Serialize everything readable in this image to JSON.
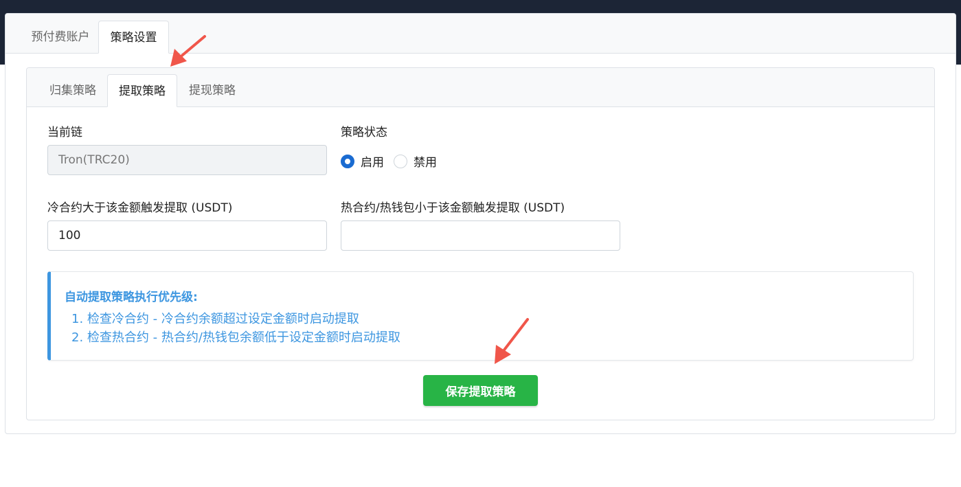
{
  "outer_tabs": [
    {
      "label": "预付费账户",
      "active": false
    },
    {
      "label": "策略设置",
      "active": true
    }
  ],
  "inner_tabs": [
    {
      "label": "归集策略",
      "active": false
    },
    {
      "label": "提取策略",
      "active": true
    },
    {
      "label": "提现策略",
      "active": false
    }
  ],
  "form": {
    "chain_label": "当前链",
    "chain_value": "Tron(TRC20)",
    "status_label": "策略状态",
    "status_options": [
      "启用",
      "禁用"
    ],
    "status_selected": "启用",
    "cold_label": "冷合约大于该金额触发提取 (USDT)",
    "cold_value": "100",
    "hot_label": "热合约/热钱包小于该金额触发提取 (USDT)",
    "hot_value": ""
  },
  "info": {
    "title": "自动提取策略执行优先级:",
    "items": [
      "1. 检查冷合约 - 冷合约余额超过设定金额时启动提取",
      "2. 检查热合约 - 热合约/热钱包余额低于设定金额时启动提取"
    ]
  },
  "save_label": "保存提取策略",
  "colors": {
    "topbar": "#1c2536",
    "accent_blue": "#3d96e0",
    "radio_blue": "#1a6bd1",
    "save_green": "#28b446",
    "annotation_arrow": "#f0564a"
  }
}
